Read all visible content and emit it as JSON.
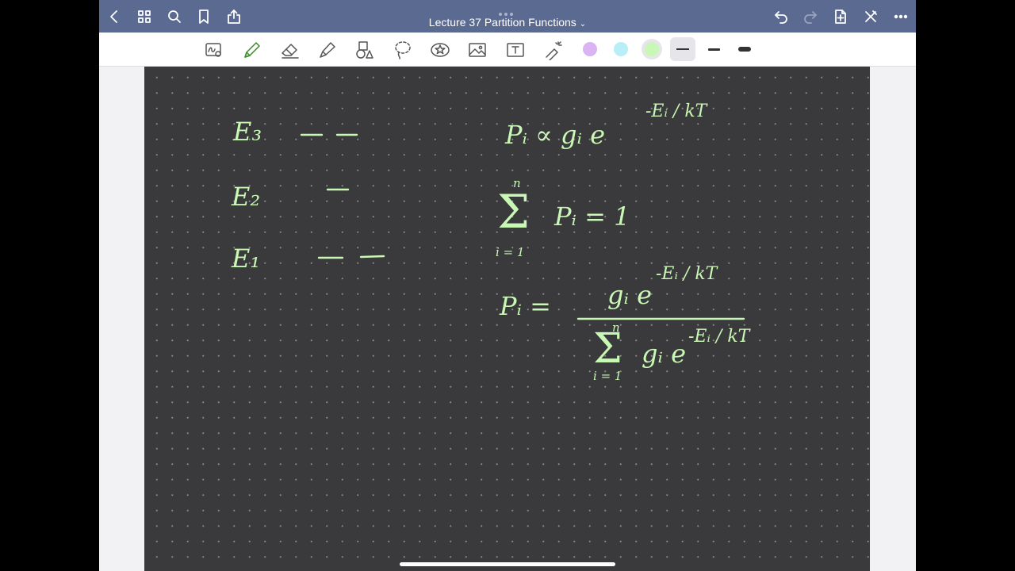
{
  "app": {
    "document_title": "Lecture 37 Partition Functions",
    "title_chevron": "⌄"
  },
  "titlebar": {
    "left_icons": [
      "back-icon",
      "grid-icon",
      "search-icon",
      "bookmark-icon",
      "share-icon"
    ],
    "right_icons": [
      "undo-icon",
      "redo-icon",
      "add-page-icon",
      "close-pen-icon",
      "more-icon"
    ],
    "redo_enabled": false
  },
  "toolbar": {
    "tools": [
      "handwriting-to-text-icon",
      "pen-icon",
      "eraser-icon",
      "highlighter-icon",
      "shapes-icon",
      "lasso-icon",
      "sticker-icon",
      "image-icon",
      "text-box-icon",
      "laser-pointer-icon"
    ],
    "active_tool": "pen-icon",
    "colors": [
      "#d9b3f2",
      "#b8eff7",
      "#c9f7b5"
    ],
    "selected_color": "#c9f7b5",
    "stroke_widths": [
      "thin",
      "medium",
      "thick"
    ],
    "selected_stroke": "thin"
  },
  "notes": {
    "level_e3": "E₃",
    "level_e2": "E₂",
    "level_e1": "E₁",
    "prop_lhs": "Pᵢ ∝ gᵢ e",
    "prop_exp": "-Eᵢ / kT",
    "sum_upper": "n",
    "sum_symbol": "Σ",
    "sum_lower": "i = 1",
    "sum_body": "Pᵢ = 1",
    "frac_lhs": "Pᵢ =",
    "frac_num": "gᵢ e",
    "frac_num_exp": "-Eᵢ / kT",
    "frac_den_upper": "n",
    "frac_den_sum": "Σ",
    "frac_den_lower": "i = 1",
    "frac_den_body": "gᵢ e",
    "frac_den_exp": "-Eᵢ / kT"
  },
  "energy_levels": [
    {
      "label": "E₃",
      "degeneracy": 2
    },
    {
      "label": "E₂",
      "degeneracy": 1
    },
    {
      "label": "E₁",
      "degeneracy": 2
    }
  ]
}
